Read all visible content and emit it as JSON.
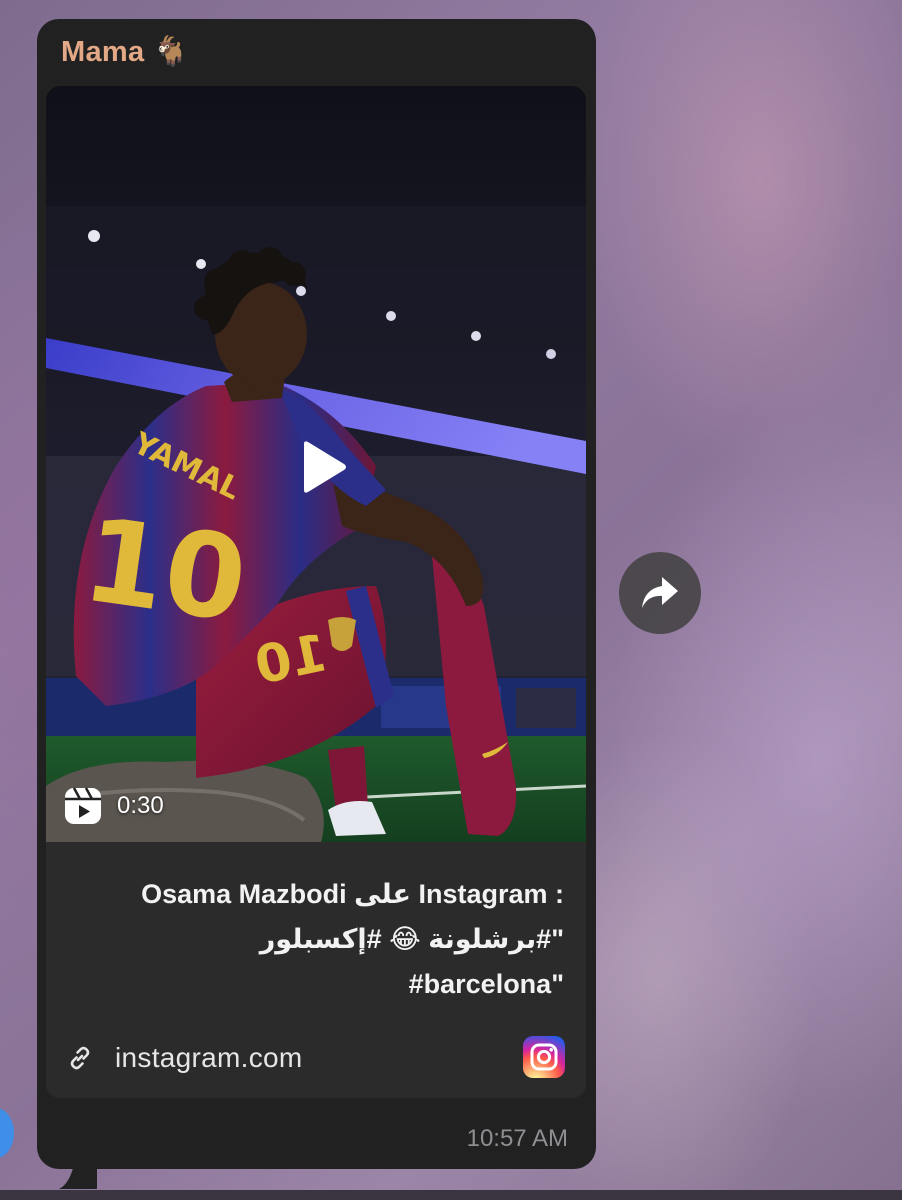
{
  "chat": {
    "sender_name": "Mama 🐐",
    "timestamp": "10:57 AM"
  },
  "preview": {
    "video_duration": "0:30",
    "caption_lines": [
      "Osama Mazbodi على Instagram :",
      "\"#برشلونة 😂 #إكسبلور",
      "#barcelona\""
    ],
    "domain": "instagram.com",
    "jersey_name": "YAMAL",
    "jersey_number": "10"
  },
  "icons": {
    "play": "play-icon",
    "reel": "reels-icon",
    "link": "link-icon",
    "instagram": "instagram-logo-icon",
    "share": "share-forward-icon"
  },
  "colors": {
    "bubble_bg": "#212121",
    "sender_color": "#e3a886",
    "timestamp_color": "#8e8e93",
    "barca_blue": "#1d2a7a",
    "barca_red": "#8a1538"
  }
}
